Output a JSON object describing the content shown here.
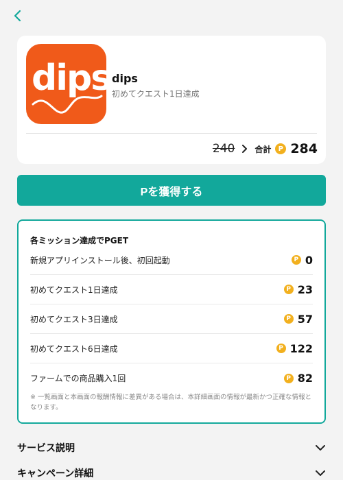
{
  "nav": {
    "back_icon": "chevron-left-icon"
  },
  "app": {
    "icon_text": "dips",
    "name": "dips",
    "subtitle": "初めてクエスト1日達成",
    "old_points": "240",
    "total_label": "合計",
    "total_points": "284",
    "coin_symbol": "P"
  },
  "cta": {
    "label": "Pを獲得する"
  },
  "missions": {
    "title": "各ミッション達成でPGET",
    "items": [
      {
        "label": "新規アプリインストール後、初回起動",
        "points": "0"
      },
      {
        "label": "初めてクエスト1日達成",
        "points": "23"
      },
      {
        "label": "初めてクエスト3日達成",
        "points": "57"
      },
      {
        "label": "初めてクエスト6日達成",
        "points": "122"
      },
      {
        "label": "ファームでの商品購入1回",
        "points": "82"
      }
    ],
    "note": "※ 一覧画面と本画面の報酬情報に差異がある場合は、本詳細画面の情報が最新かつ正確な情報となります。"
  },
  "accordions": [
    {
      "label": "サービス説明"
    },
    {
      "label": "キャンペーン詳細"
    }
  ],
  "colors": {
    "accent": "#12a89b",
    "brand": "#f05a1a",
    "coin": "#f2b01e"
  }
}
